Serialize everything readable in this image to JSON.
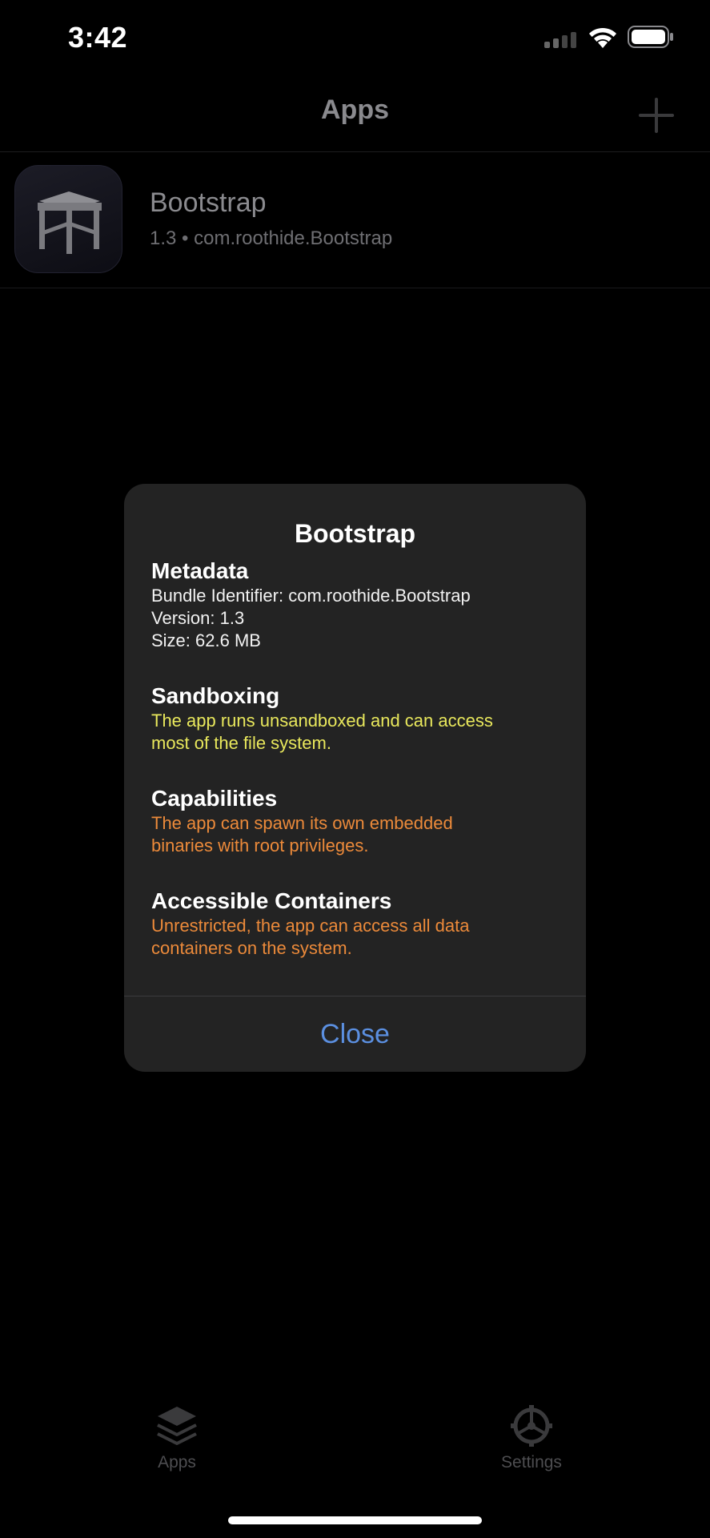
{
  "status_bar": {
    "time": "3:42",
    "icons": [
      "signal-icon",
      "wifi-icon",
      "battery-icon"
    ]
  },
  "nav": {
    "title": "Apps",
    "add_icon": "plus-icon"
  },
  "app_row": {
    "name": "Bootstrap",
    "meta": "1.3 • com.roothide.Bootstrap",
    "icon": "table-icon"
  },
  "alert": {
    "title": "Bootstrap",
    "metadata": {
      "heading": "Metadata",
      "bundle": "Bundle Identifier: com.roothide.Bootstrap",
      "version": "Version: 1.3",
      "size": "Size: 62.6 MB"
    },
    "sandboxing": {
      "heading": "Sandboxing",
      "line1": "The app runs unsandboxed and can access",
      "line2": "most of the file system."
    },
    "capabilities": {
      "heading": "Capabilities",
      "line1": "The app can spawn its own embedded",
      "line2": "binaries with root privileges."
    },
    "containers": {
      "heading": "Accessible Containers",
      "line1": "Unrestricted, the app can access all data",
      "line2": "containers on the system."
    },
    "close_label": "Close"
  },
  "tab_bar": {
    "apps_label": "Apps",
    "settings_label": "Settings"
  },
  "colors": {
    "background": "#000000",
    "alert_bg": "#232323",
    "accent_blue": "#5b8fe0",
    "warning_yellow": "#e9e85c",
    "warning_orange": "#ec8a3a"
  }
}
